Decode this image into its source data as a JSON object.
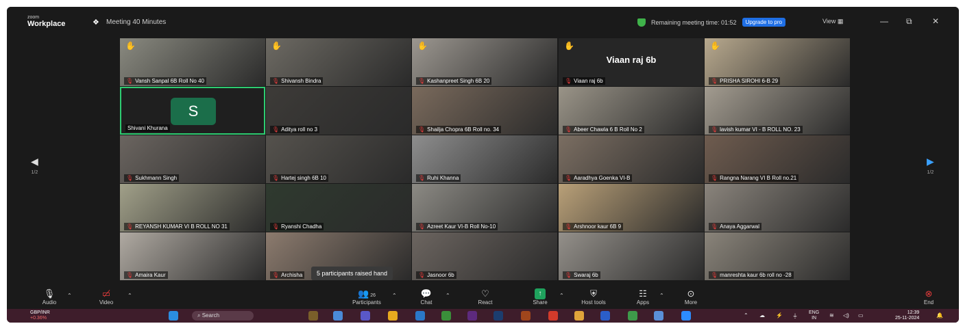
{
  "titlebar": {
    "brand_small": "zoom",
    "brand_big": "Workplace",
    "meeting_title": "Meeting 40 Minutes",
    "remaining": "Remaining meeting time: 01:52",
    "upgrade": "Upgrade to pro",
    "view": "View",
    "minimize": "—",
    "restore": "⧉",
    "close": "✕"
  },
  "tiles": [
    {
      "name": "Vansh Sanpal 6B Roll No 40",
      "hand": true,
      "scene": "#8a8a80"
    },
    {
      "name": "Shivansh Bindra",
      "hand": true,
      "scene": "#6d6a63"
    },
    {
      "name": "Kashanpreet Singh 6B 20",
      "hand": true,
      "scene": "#9c9790"
    },
    {
      "name": "Viaan raj 6b",
      "hand": true,
      "center": "Viaan raj 6b"
    },
    {
      "name": "PRISHA SIROHI 6-B 29",
      "hand": true,
      "scene": "#b8a98e"
    },
    {
      "name": "Shivani Khurana",
      "avatar": "S",
      "active": true
    },
    {
      "name": "Aditya roll no 3",
      "scene": "#3d3b38"
    },
    {
      "name": "Shailja Chopra 6B Roll no. 34",
      "scene": "#7a6a5c"
    },
    {
      "name": "Abeer Chawla 6 B Roll No 2",
      "scene": "#9a9488"
    },
    {
      "name": "lavish kumar VI - B ROLL NO. 23",
      "scene": "#a39c90"
    },
    {
      "name": "Sukhmann Singh",
      "scene": "#6b6560"
    },
    {
      "name": "Hartej singh 6B 10",
      "scene": "#55524d"
    },
    {
      "name": "Ruhi Khanna",
      "scene": "#8e8e8e"
    },
    {
      "name": "Aaradhya Goenka VI-B",
      "scene": "#7b6e62"
    },
    {
      "name": "Rangna Narang VI B Roll no.21",
      "scene": "#6f5c4f"
    },
    {
      "name": "REYANSH KUMAR VI B ROLL NO 31",
      "scene": "#a1a089"
    },
    {
      "name": "Ryanshi Chadha",
      "scene": "#2f3a2f"
    },
    {
      "name": "Azreet Kaur VI-B Roll No-10",
      "scene": "#8c8a84"
    },
    {
      "name": "Arshnoor kaur 6B 9",
      "scene": "#b9a078"
    },
    {
      "name": "Anaya Aggarwal",
      "scene": "#8a847c"
    },
    {
      "name": "Amaira Kaur",
      "scene": "#b0aaa2"
    },
    {
      "name": "Archisha",
      "scene": "#8c7b6e"
    },
    {
      "name": "Jasnoor 6b",
      "scene": "#6c6560"
    },
    {
      "name": "Swaraj 6b",
      "scene": "#94908a"
    },
    {
      "name": "manreshta kaur 6b roll no -28",
      "scene": "#8a847a"
    }
  ],
  "nav": {
    "left_page": "1/2",
    "right_page": "1/2"
  },
  "tooltip": "5 participants raised hand",
  "toolbar": {
    "audio": "Audio",
    "video": "Video",
    "participants": "Participants",
    "participants_count": "26",
    "chat": "Chat",
    "react": "React",
    "share": "Share",
    "host_tools": "Host tools",
    "apps": "Apps",
    "more": "More",
    "end": "End"
  },
  "taskbar": {
    "ticker_name": "GBP/INR",
    "ticker_change": "+0.36%",
    "search": "Search",
    "lang_top": "ENG",
    "lang_bottom": "IN",
    "time": "12:39",
    "date": "25-11-2024"
  }
}
